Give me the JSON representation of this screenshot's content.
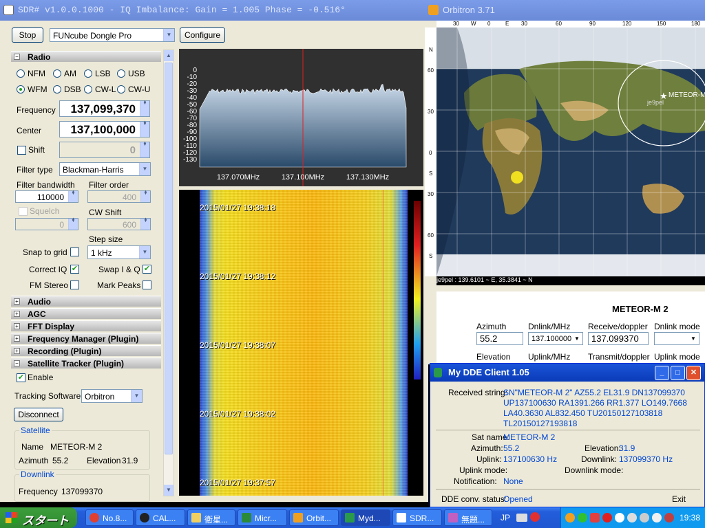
{
  "sdr": {
    "title": "SDR# v1.0.0.1000 - IQ Imbalance: Gain = 1.005 Phase = -0.516°",
    "stop_label": "Stop",
    "device": "FUNcube Dongle Pro",
    "configure_label": "Configure",
    "radio_section": "Radio",
    "modes": [
      "NFM",
      "AM",
      "LSB",
      "USB",
      "WFM",
      "DSB",
      "CW-L",
      "CW-U"
    ],
    "selected_mode": "WFM",
    "frequency_label": "Frequency",
    "frequency": "137,099,370",
    "center_label": "Center",
    "center": "137,100,000",
    "shift_label": "Shift",
    "shift": "0",
    "filter_type_label": "Filter type",
    "filter_type": "Blackman-Harris",
    "filter_bandwidth_label": "Filter bandwidth",
    "filter_bandwidth": "110000",
    "filter_order_label": "Filter order",
    "filter_order": "400",
    "squelch_label": "Squelch",
    "squelch": "0",
    "cw_shift_label": "CW Shift",
    "cw_shift": "600",
    "step_size_label": "Step size",
    "step_size": "1 kHz",
    "snap_label": "Snap to grid",
    "correct_iq_label": "Correct IQ",
    "swap_label": "Swap I & Q",
    "fm_stereo_label": "FM Stereo",
    "mark_peaks_label": "Mark Peaks",
    "sections": [
      "Audio",
      "AGC",
      "FFT Display",
      "Frequency Manager (Plugin)",
      "Recording (Plugin)",
      "Satellite Tracker (Plugin)"
    ],
    "enable_label": "Enable",
    "tracking_label": "Tracking Software",
    "tracking_value": "Orbitron",
    "disconnect_label": "Disconnect",
    "satellite_group": "Satellite",
    "name_label": "Name",
    "sat_name": "METEOR-M 2",
    "azimuth_label": "Azimuth",
    "azimuth": "55.2",
    "elevation_label": "Elevation",
    "elevation": "31.9",
    "downlink_group": "Downlink",
    "dl_freq_label": "Frequency",
    "dl_freq": "137099370",
    "spectrum_db": [
      "0",
      "-10",
      "-20",
      "-30",
      "-40",
      "-50",
      "-60",
      "-70",
      "-80",
      "-90",
      "-100",
      "-110",
      "-120",
      "-130"
    ],
    "spectrum_freqs": [
      "137.070MHz",
      "137.100MHz",
      "137.130MHz"
    ],
    "waterfall_stamps": [
      "2015/01/27 19:38:18",
      "2015/01/27 19:38:12",
      "2015/01/27 19:38:07",
      "2015/01/27 19:38:02",
      "2015/01/27 19:37:57"
    ]
  },
  "orb": {
    "title": "Orbitron 3.71",
    "top_ticks": [
      "30",
      "W",
      "0",
      "E",
      "30",
      "60",
      "90",
      "120",
      "150",
      "180"
    ],
    "lat_ticks": [
      "N",
      "60",
      "30",
      "0",
      "S",
      "30",
      "60",
      "S"
    ],
    "sat_label": "METEOR-M",
    "obs_label": "je9pel",
    "status": "je9pel : 139.6101 ~ E, 35.3841 ~ N",
    "sat_name": "METEOR-M 2",
    "azimuth_label": "Azimuth",
    "azimuth": "55.2",
    "dnlink_label": "Dnlink/MHz",
    "dnlink": "137.100000",
    "receive_label": "Receive/doppler",
    "receive": "137.099370",
    "dnmode_label": "Dnlink mode",
    "elevation_label": "Elevation",
    "uplink_label": "Uplink/MHz",
    "transmit_label": "Transmit/doppler",
    "upmode_label": "Uplink mode"
  },
  "dde": {
    "title": "My DDE Client 1.05",
    "received_label": "Received string:",
    "received": [
      "SN\"METEOR-M 2\" AZ55.2 EL31.9 DN137099370",
      "UP137100630 RA1391.266 RR1.377 LO149.7668",
      "LA40.3630 AL832.450 TU20150127103818",
      "TL20150127193818"
    ],
    "sat_name_label": "Sat name:",
    "sat_name": "METEOR-M 2",
    "azimuth_label": "Azimuth:",
    "azimuth": "55.2",
    "elevation_label": "Elevation:",
    "elevation": "31.9",
    "uplink_label": "Uplink:",
    "uplink": "137100630 Hz",
    "downlink_label": "Downlink:",
    "downlink": "137099370 Hz",
    "uplink_mode_label": "Uplink mode:",
    "downlink_mode_label": "Downlink mode:",
    "notification_label": "Notification:",
    "notification": "None",
    "status_label": "DDE conv. status:",
    "status": "Opened",
    "exit_label": "Exit"
  },
  "taskbar": {
    "start": "スタート",
    "items": [
      "No.8...",
      "CAL...",
      "衛星...",
      "Micr...",
      "Orbit...",
      "Myd...",
      "SDR...",
      "無題..."
    ],
    "lang": "JP",
    "clock": "19:38"
  }
}
